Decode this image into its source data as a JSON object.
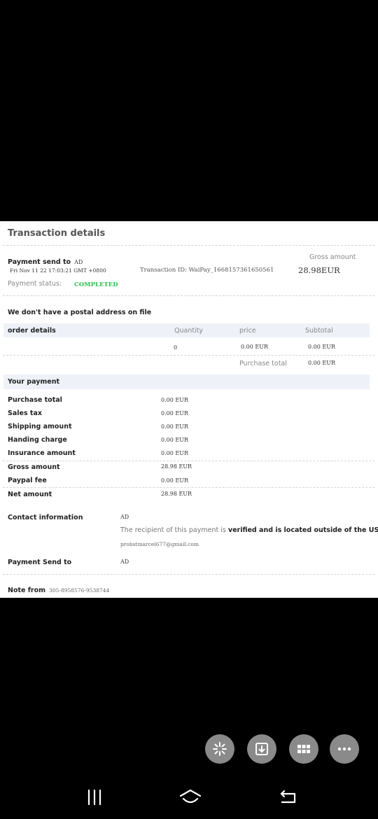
{
  "title": "Transaction details",
  "header": {
    "payment_send_label": "Payment send to",
    "payment_send_value": "AD",
    "gross_amount_label": "Gross amount",
    "gross_amount_value": "28.98EUR",
    "date": "Fri Nov 11 22 17:03:21 GMT +0800",
    "transaction_id": "Transaction ID: WaiPay_1668157361650561",
    "status_label": "Payment status:",
    "status_value": "COMPLETED"
  },
  "postal_notice": "We don't have a postal address on file",
  "order": {
    "heading": "order details",
    "col_quantity": "Quantity",
    "col_price": "price",
    "col_subtotal": "Subtotal",
    "quantity": "0",
    "price": "0.00 EUR",
    "subtotal": "0.00 EUR",
    "purchase_total_label": "Purchase total",
    "purchase_total_value": "0.00 EUR"
  },
  "your_payment": {
    "heading": "Your payment",
    "rows": [
      {
        "label": "Purchase total",
        "value": "0.00 EUR"
      },
      {
        "label": "Sales tax",
        "value": "0.00 EUR"
      },
      {
        "label": "Shipping amount",
        "value": "0.00 EUR"
      },
      {
        "label": "Handing charge",
        "value": "0.00 EUR"
      },
      {
        "label": "Insurance amount",
        "value": "0.00 EUR"
      },
      {
        "label": "Gross amount",
        "value": "28.98 EUR"
      },
      {
        "label": "Paypal fee",
        "value": "0.00 EUR"
      },
      {
        "label": "Net amount",
        "value": "28.98 EUR"
      }
    ]
  },
  "contact": {
    "label": "Contact information",
    "name": "AD",
    "recipient_prefix": "The recipient of this payment is",
    "recipient_bold": "verified and is located outside of the US.",
    "email": "probstmarcel677@gmail.com"
  },
  "payment_send_to": {
    "label": "Payment Send to",
    "value": "AD"
  },
  "note": {
    "label": "Note from",
    "value": "305-8958576-9538744"
  },
  "actions": [
    "scan-icon",
    "download-icon",
    "grid-icon",
    "more-icon"
  ],
  "navbar": [
    "recent-apps-icon",
    "home-icon",
    "back-icon"
  ]
}
